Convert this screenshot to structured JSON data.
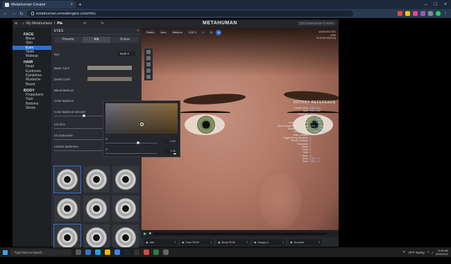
{
  "browser": {
    "tab_title": "MetaHuman Creator",
    "url": "metahuman.unrealengine.com/mhc"
  },
  "app": {
    "breadcrumb_root": "My Metahumans",
    "breadcrumb_current": "Pia",
    "logo": "METAHUMAN",
    "account_text": "[ID] MetaHuman Creator"
  },
  "leftnav": {
    "face_title": "FACE",
    "face_items": [
      "Blend",
      "Skin",
      "Eyes",
      "Teeth",
      "Makeup"
    ],
    "hair_title": "HAIR",
    "hair_items": [
      "Head",
      "Eyebrows",
      "Eyelashes",
      "Mustache",
      "Beard"
    ],
    "body_title": "BODY",
    "body_items": [
      "Proportions",
      "Tops",
      "Bottoms",
      "Shoes"
    ]
  },
  "panel": {
    "title": "EYES",
    "tabs": [
      "Presets",
      "Iris",
      "Sclera"
    ],
    "eye_label": "Eye",
    "eye_value": "Both",
    "base_color": "Base Color",
    "detail_color": "Detail Color",
    "blend_method": "Blend Method",
    "color_balance": "Color Balance",
    "color_balance_smooth": "Color Balance Smooth",
    "iris_size": "Iris Size",
    "iris_saturation": "Iris Saturation",
    "limbus_darkness": "Limbus Darkness",
    "limbus_value": "0.90",
    "picker_u_label": "U",
    "picker_u_value": "0.50",
    "picker_v_label": "V",
    "picker_v_value": "1.00"
  },
  "viewport": {
    "chips": [
      "Studio",
      "Auto",
      "Medium",
      "LOD 1"
    ],
    "top_right": [
      "13:40:004:7471",
      "4.9%",
      "16:22:41:33(4:13)"
    ],
    "hotkey_title": "HOTKEY REFERENCE",
    "hotkeys": [
      [
        "Camera Pivot",
        "RMB Click"
      ],
      [
        "Orbit",
        "RMB Hold"
      ],
      [
        "Pan/Dolly",
        "MMB"
      ],
      [
        "Pan",
        "ALT + MMB"
      ],
      [
        "Zoom",
        "ALT + RMB"
      ],
      [
        "Move Global Pivot",
        "Ctrl + LMB"
      ],
      [
        "Move Global Pivot Horizontal",
        "CTRL + LMB"
      ],
      [
        "Rotate Global Pivot",
        "SHIFT + LMB"
      ],
      [
        "Rotate Lights",
        "L + Move Mouse"
      ],
      [
        "Show Hotkeys",
        "? + K"
      ],
      [
        "Toggle Debug Renderer",
        "D"
      ],
      [
        "Render Settings",
        "R"
      ],
      [
        "Fullscreen",
        "F"
      ],
      [
        "Reset",
        "Z"
      ],
      [
        "Show",
        "X"
      ],
      [
        "Hide",
        "H"
      ],
      [
        "Move",
        "M"
      ],
      [
        "Undo",
        "CTRL + Z"
      ],
      [
        "Redo",
        "CTRL + Y"
      ]
    ],
    "anims": [
      "Idle",
      "Face ROM",
      "Body ROM",
      "Happy A",
      "Surprise"
    ]
  },
  "taskbar": {
    "search_placeholder": "Type here to search",
    "weather": "73°F Sunny",
    "time": "5:45 AM",
    "date": "8/24/2022"
  }
}
